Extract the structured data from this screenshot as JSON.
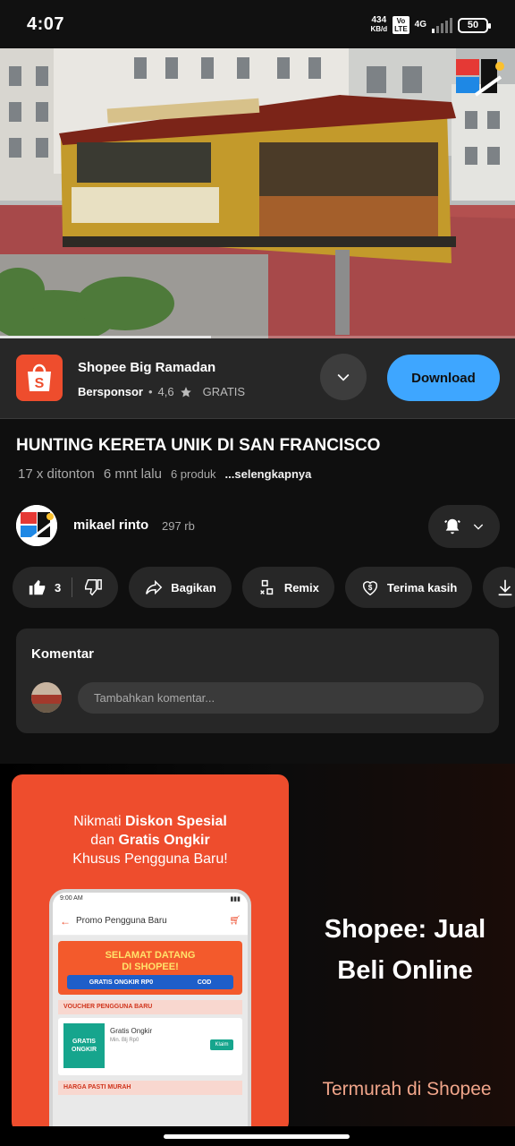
{
  "status_bar": {
    "time": "4:07",
    "net_speed_value": "434",
    "net_speed_unit": "KB/d",
    "volte_label": "Vo\nLTE",
    "network_label": "4G",
    "battery": "50"
  },
  "ad": {
    "app_name": "Shopee Big Ramadan",
    "sponsored_label": "Bersponsor",
    "rating": "4,6",
    "price_label": "GRATIS",
    "download_label": "Download"
  },
  "video": {
    "title": "HUNTING KERETA UNIK DI SAN FRANCISCO",
    "views": "17 x ditonton",
    "uploaded": "6 mnt lalu",
    "products": "6 produk",
    "more_label": "...selengkapnya",
    "progress": 0.41
  },
  "channel": {
    "name": "mikael rinto",
    "subscribers": "297 rb"
  },
  "actions": {
    "like_count": "3",
    "share_label": "Bagikan",
    "remix_label": "Remix",
    "thanks_label": "Terima kasih"
  },
  "comments": {
    "title": "Komentar",
    "placeholder": "Tambahkan komentar..."
  },
  "promo": {
    "headline_1a": "Nikmati ",
    "headline_1b": "Diskon Spesial",
    "headline_2a": "dan ",
    "headline_2b": "Gratis Ongkir",
    "headline_3": "Khusus Pengguna Baru!",
    "phone_time": "9:00 AM",
    "phone_header": "Promo Pengguna Baru",
    "banner_line1": "SELAMAT DATANG",
    "banner_line2": "DI SHOPEE!",
    "banner_gratis": "GRATIS ONGKIR RP0",
    "banner_cod": "COD",
    "voucher_section": "VOUCHER PENGGUNA BARU",
    "voucher_badge": "GRATIS ONGKIR",
    "voucher_title": "Gratis Ongkir",
    "voucher_sub": "Min. Blj Rp0",
    "voucher_claim": "Klaim",
    "harga_section": "HARGA PASTI MURAH",
    "title": "Shopee: Jual Beli Online",
    "tagline": "Termurah di Shopee"
  },
  "colors": {
    "accent_blue": "#3ea6ff",
    "shopee_orange": "#ee4d2d",
    "surface": "#272727",
    "background": "#0f0f0f"
  }
}
